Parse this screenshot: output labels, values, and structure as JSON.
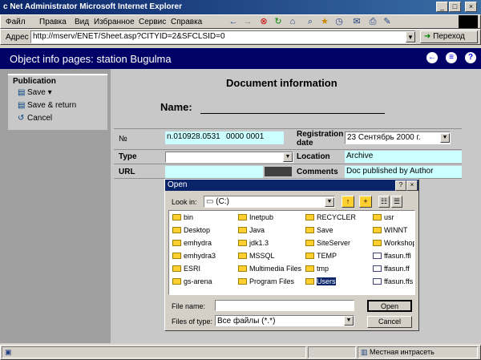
{
  "window": {
    "title": "c Net  Administrator  Microsoft Internet Explorer",
    "buttons": [
      "_",
      "□",
      "×"
    ]
  },
  "menu": [
    "Файл",
    "Правка",
    "Вид",
    "Избранное",
    "Сервис",
    "Справка"
  ],
  "toolbar_icons": [
    "back-icon",
    "forward-icon",
    "stop-icon",
    "refresh-icon",
    "home-icon",
    "search-icon",
    "favorites-icon",
    "history-icon",
    "mail-icon",
    "print-icon",
    "edit-icon"
  ],
  "address": {
    "label": "Адрес",
    "url": "http://mserv/ENET/Sheet.asp?CITYID=2&SFCLSID=0",
    "go_label": "Переход"
  },
  "header": {
    "title": "Object info pages: station  Bugulma"
  },
  "sidebar": {
    "section": "Publication",
    "items": [
      {
        "label": "Save",
        "icon": "save-icon"
      },
      {
        "label": "Save & return",
        "icon": "save-return-icon"
      },
      {
        "label": "Cancel",
        "icon": "cancel-icon"
      }
    ]
  },
  "doc": {
    "title": "Document information",
    "name_label": "Name:",
    "number_label": "№",
    "number_value": "n.010928.0531",
    "number_value2": "0000 0001",
    "reg_date_label": "Registration date",
    "reg_date_value": "23 Сентябрь 2000 г.",
    "type_label": "Type",
    "type_value": "",
    "location_label": "Location",
    "location_value": "Archive",
    "url_label": "URL",
    "url_value": "",
    "comments_label": "Comments",
    "comments_value": "Doc published by Author"
  },
  "dialog": {
    "title": "Open",
    "look_in_label": "Look in:",
    "look_in_value": "(C:)",
    "files": [
      {
        "name": "bin",
        "type": "folder"
      },
      {
        "name": "Desktop",
        "type": "folder"
      },
      {
        "name": "emhydra",
        "type": "folder"
      },
      {
        "name": "emhydra3",
        "type": "folder"
      },
      {
        "name": "ESRI",
        "type": "folder"
      },
      {
        "name": "gs-arena",
        "type": "folder"
      },
      {
        "name": "Inetpub",
        "type": "folder"
      },
      {
        "name": "Java",
        "type": "folder"
      },
      {
        "name": "jdk1.3",
        "type": "folder"
      },
      {
        "name": "MSSQL",
        "type": "folder"
      },
      {
        "name": "Multimedia Files",
        "type": "folder"
      },
      {
        "name": "Program Files",
        "type": "folder"
      },
      {
        "name": "RECYCLER",
        "type": "folder"
      },
      {
        "name": "Save",
        "type": "folder"
      },
      {
        "name": "SiteServer",
        "type": "folder"
      },
      {
        "name": "TEMP",
        "type": "folder"
      },
      {
        "name": "tmp",
        "type": "folder"
      },
      {
        "name": "Users",
        "type": "folder"
      },
      {
        "name": "usr",
        "type": "folder"
      },
      {
        "name": "WINNT",
        "type": "folder"
      },
      {
        "name": "Workshop",
        "type": "folder"
      },
      {
        "name": "ffasun.ffl",
        "type": "file"
      },
      {
        "name": "ffasun.ff",
        "type": "file"
      },
      {
        "name": "ffasun.ffs",
        "type": "file"
      }
    ],
    "filename_label": "File name:",
    "filename_value": "",
    "filetype_label": "Files of type:",
    "filetype_value": "Все файлы (*.*)",
    "open_label": "Open",
    "cancel_label": "Cancel"
  },
  "status": {
    "left": "",
    "zone": "Местная интрасеть"
  }
}
